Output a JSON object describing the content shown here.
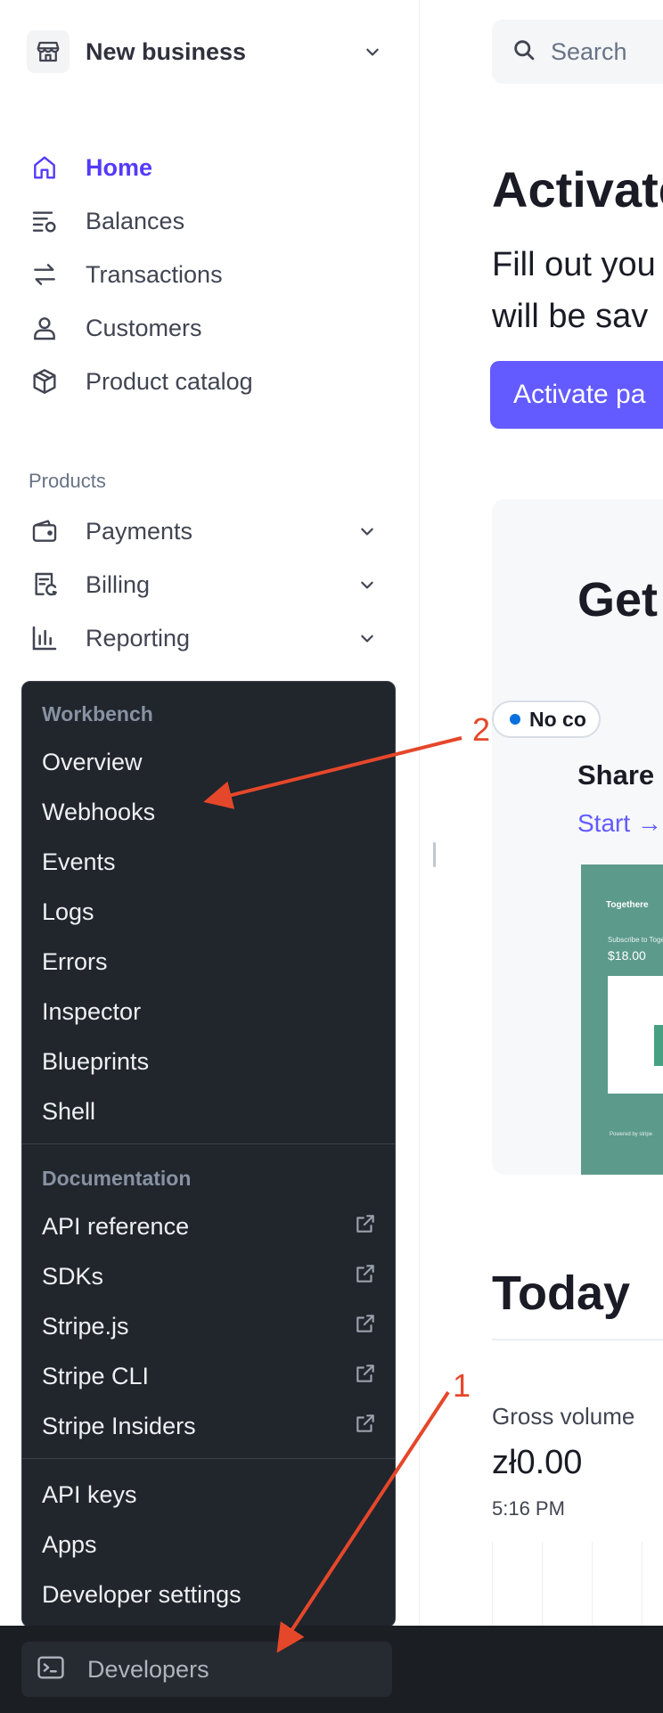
{
  "sidebar": {
    "business_name": "New business",
    "nav": [
      {
        "label": "Home",
        "icon": "home-icon",
        "active": true
      },
      {
        "label": "Balances",
        "icon": "balances-icon"
      },
      {
        "label": "Transactions",
        "icon": "transactions-icon"
      },
      {
        "label": "Customers",
        "icon": "customers-icon"
      },
      {
        "label": "Product catalog",
        "icon": "product-catalog-icon"
      }
    ],
    "products_label": "Products",
    "products": [
      {
        "label": "Payments",
        "icon": "payments-icon"
      },
      {
        "label": "Billing",
        "icon": "billing-icon"
      },
      {
        "label": "Reporting",
        "icon": "reporting-icon"
      }
    ]
  },
  "main": {
    "search_placeholder": "Search",
    "activate_title": "Activate",
    "fill_text_line1": "Fill out you",
    "fill_text_line2": "will be sav",
    "activate_button": "Activate pa",
    "card": {
      "title": "Get",
      "badge": "No co",
      "share_title": "Share",
      "start_link": "Start →",
      "preview_brand": "Togethere",
      "preview_subscribe": "Subscribe to Togethere",
      "preview_price": "$18.00",
      "preview_powered": "Powered by stripe"
    },
    "today_title": "Today",
    "gross_volume_label": "Gross volume",
    "gross_volume_value": "zł0.00",
    "gross_volume_time": "5:16 PM"
  },
  "menu": {
    "workbench_header": "Workbench",
    "workbench_items": [
      "Overview",
      "Webhooks",
      "Events",
      "Logs",
      "Errors",
      "Inspector",
      "Blueprints",
      "Shell"
    ],
    "documentation_header": "Documentation",
    "documentation_items": [
      "API reference",
      "SDKs",
      "Stripe.js",
      "Stripe CLI",
      "Stripe Insiders"
    ],
    "other_items": [
      "API keys",
      "Apps",
      "Developer settings"
    ]
  },
  "bottom": {
    "developers_label": "Developers"
  },
  "annotations": {
    "arrow1_label": "1",
    "arrow2_label": "2",
    "color": "#e5472a"
  },
  "colors": {
    "accent": "#533afd",
    "button": "#635bff",
    "menu_bg": "#21252c"
  }
}
